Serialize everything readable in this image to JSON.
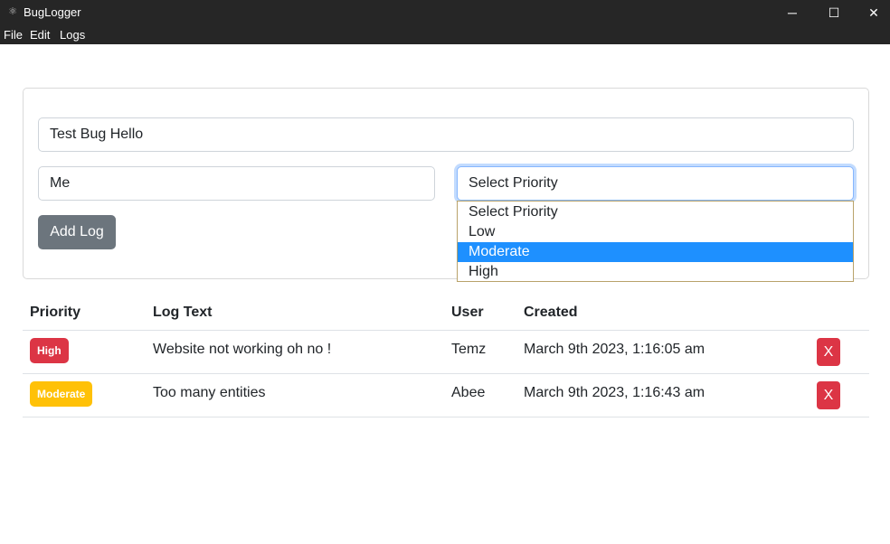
{
  "window": {
    "title": "BugLogger",
    "controls": {
      "minimize": "─",
      "maximize": "☐",
      "close": "✕"
    },
    "app_icon": "atom-icon"
  },
  "menu": [
    "File",
    "Edit",
    "Logs"
  ],
  "form": {
    "text_value": "Test Bug Hello",
    "user_value": "Me",
    "priority_select": {
      "selected": "Select Priority",
      "options": [
        "Select Priority",
        "Low",
        "Moderate",
        "High"
      ],
      "highlighted": "Moderate"
    },
    "add_button": "Add Log"
  },
  "table": {
    "headers": [
      "Priority",
      "Log Text",
      "User",
      "Created"
    ],
    "rows": [
      {
        "priority": "High",
        "priority_color": "#dc3545",
        "text": "Website not working oh no !",
        "user": "Temz",
        "created": "March 9th 2023, 1:16:05 am",
        "delete": "X"
      },
      {
        "priority": "Moderate",
        "priority_color": "#ffc107",
        "text": "Too many entities",
        "user": "Abee",
        "created": "March 9th 2023, 1:16:43 am",
        "delete": "X"
      }
    ]
  },
  "colors": {
    "titlebar": "#262626",
    "button_secondary": "#6c757d",
    "danger": "#dc3545",
    "warning": "#ffc107",
    "highlight": "#1e90ff"
  }
}
